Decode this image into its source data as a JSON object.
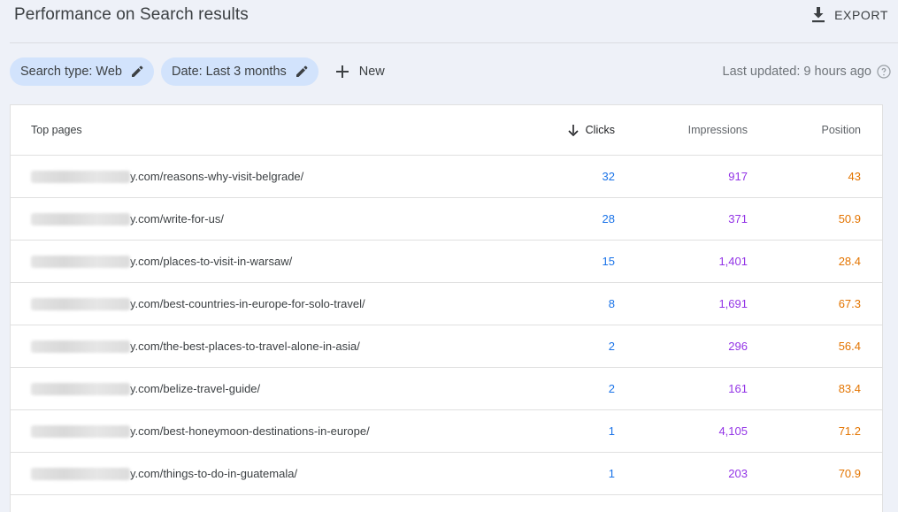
{
  "header": {
    "title": "Performance on Search results",
    "export_label": "EXPORT"
  },
  "filters": {
    "chips": [
      {
        "label": "Search type: Web"
      },
      {
        "label": "Date: Last 3 months"
      }
    ],
    "new_label": "New",
    "last_updated": "Last updated: 9 hours ago"
  },
  "table": {
    "columns": {
      "page": "Top pages",
      "clicks": "Clicks",
      "impressions": "Impressions",
      "position": "Position"
    },
    "rows": [
      {
        "page": "y.com/reasons-why-visit-belgrade/",
        "clicks": "32",
        "impressions": "917",
        "position": "43"
      },
      {
        "page": "y.com/write-for-us/",
        "clicks": "28",
        "impressions": "371",
        "position": "50.9"
      },
      {
        "page": "y.com/places-to-visit-in-warsaw/",
        "clicks": "15",
        "impressions": "1,401",
        "position": "28.4"
      },
      {
        "page": "y.com/best-countries-in-europe-for-solo-travel/",
        "clicks": "8",
        "impressions": "1,691",
        "position": "67.3"
      },
      {
        "page": "y.com/the-best-places-to-travel-alone-in-asia/",
        "clicks": "2",
        "impressions": "296",
        "position": "56.4"
      },
      {
        "page": "y.com/belize-travel-guide/",
        "clicks": "2",
        "impressions": "161",
        "position": "83.4"
      },
      {
        "page": "y.com/best-honeymoon-destinations-in-europe/",
        "clicks": "1",
        "impressions": "4,105",
        "position": "71.2"
      },
      {
        "page": "y.com/things-to-do-in-guatemala/",
        "clicks": "1",
        "impressions": "203",
        "position": "70.9"
      }
    ]
  },
  "colors": {
    "clicks": "#1a73e8",
    "impressions": "#9334e6",
    "position": "#e37400",
    "chip_bg": "#d2e3fc"
  }
}
